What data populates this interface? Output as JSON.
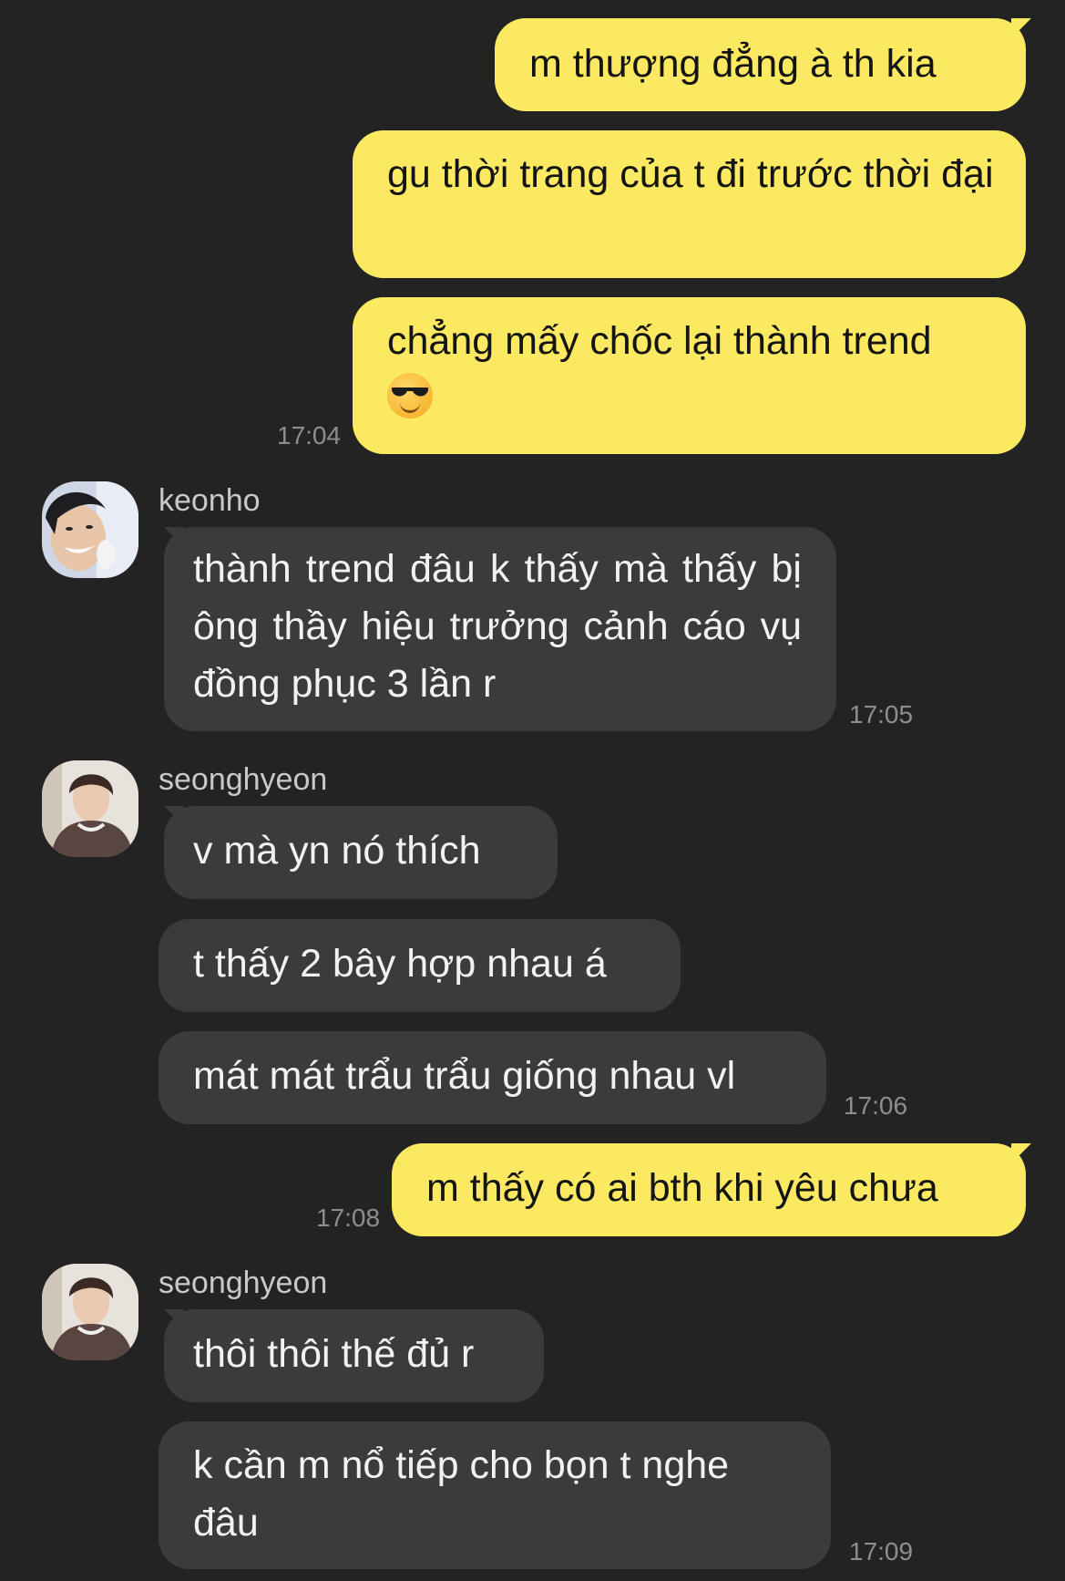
{
  "messages": [
    {
      "id": "m1",
      "direction": "out",
      "text": "m thượng đẳng à th kia"
    },
    {
      "id": "m2",
      "direction": "out",
      "text": "gu thời trang của t đi trước thời đại"
    },
    {
      "id": "m3",
      "direction": "out",
      "text": "chẳng mấy chốc lại thành trend",
      "emoji": "sunglasses-emoji",
      "time": "17:04"
    },
    {
      "id": "m4",
      "direction": "in",
      "sender": "keonho",
      "text": "thành trend đâu k thấy mà thấy bị ông thầy hiệu trưởng cảnh cáo vụ đồng phục 3 lần r",
      "time": "17:05"
    },
    {
      "id": "m5",
      "direction": "in",
      "sender": "seonghyeon",
      "text": "v mà yn nó thích"
    },
    {
      "id": "m6",
      "direction": "in",
      "text": "t thấy 2 bây hợp nhau á"
    },
    {
      "id": "m7",
      "direction": "in",
      "text": "mát mát trẩu trẩu giống nhau vl",
      "time": "17:06"
    },
    {
      "id": "m8",
      "direction": "out",
      "text": "m thấy có ai bth khi yêu chưa",
      "time": "17:08"
    },
    {
      "id": "m9",
      "direction": "in",
      "sender": "seonghyeon",
      "text": "thôi thôi thế đủ r"
    },
    {
      "id": "m10",
      "direction": "in",
      "text": "k cần m nổ tiếp cho bọn t nghe đâu",
      "time": "17:09"
    }
  ],
  "colors": {
    "background": "#232323",
    "outgoing_bubble": "#fbea61",
    "incoming_bubble": "#3b3b3b",
    "timestamp": "#8e8e8e"
  }
}
